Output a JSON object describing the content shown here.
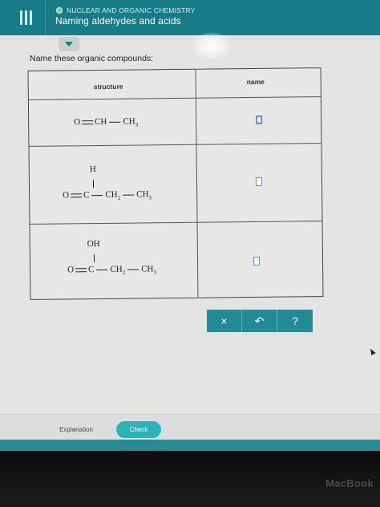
{
  "header": {
    "topic": "NUCLEAR AND ORGANIC CHEMISTRY",
    "title": "Naming aldehydes and acids"
  },
  "prompt": "Name these organic compounds:",
  "table": {
    "col_structure": "structure",
    "col_name": "name",
    "rows": [
      {
        "structure": {
          "left": "O",
          "mid": "CH",
          "right": "CH",
          "right_sub": "3"
        },
        "name_value": ""
      },
      {
        "structure": {
          "top": "H",
          "left": "O",
          "c": "C",
          "ch2": "CH",
          "ch2_sub": "2",
          "ch3": "CH",
          "ch3_sub": "3"
        },
        "name_value": ""
      },
      {
        "structure": {
          "top": "OH",
          "left": "O",
          "c": "C",
          "ch2": "CH",
          "ch2_sub": "2",
          "ch3": "CH",
          "ch3_sub": "3"
        },
        "name_value": ""
      }
    ]
  },
  "actions": {
    "clear": "×",
    "undo": "↶",
    "help": "?"
  },
  "footer": {
    "explanation": "Explanation",
    "check": "Check"
  },
  "bezel_brand": "MacBook",
  "colors": {
    "header": "#187c88",
    "accent": "#1f8c96",
    "check": "#2ab3b9"
  }
}
